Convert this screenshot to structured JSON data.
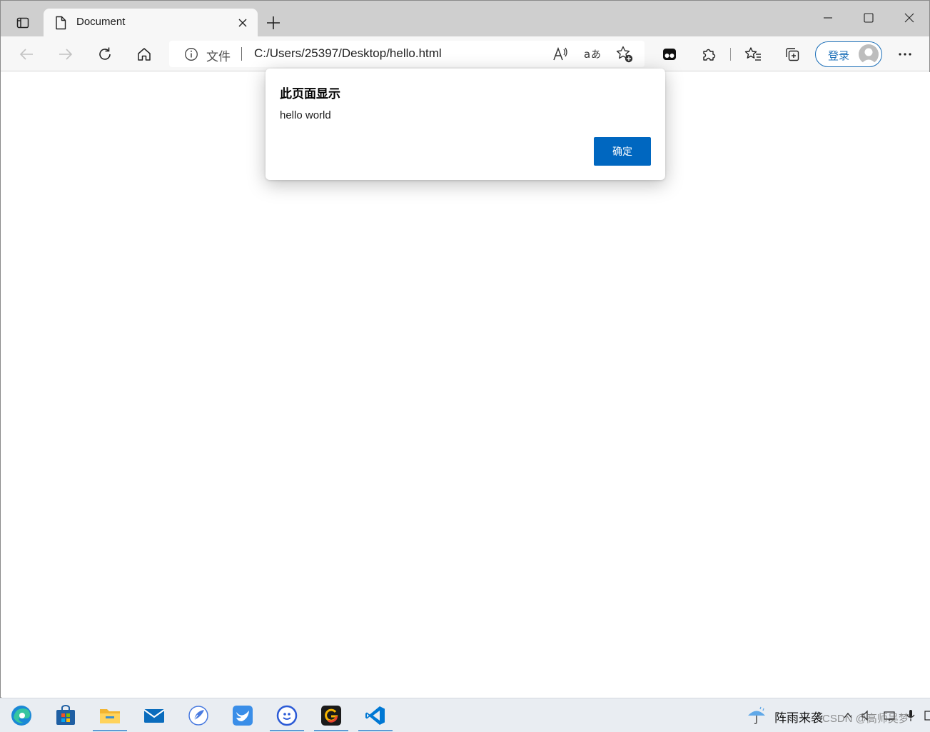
{
  "browser": {
    "tab": {
      "title": "Document"
    },
    "address": {
      "scheme_label": "文件",
      "url": "C:/Users/25397/Desktop/hello.html"
    },
    "signin_label": "登录"
  },
  "dialog": {
    "title": "此页面显示",
    "message": "hello world",
    "ok_label": "确定"
  },
  "taskbar": {
    "weather_text": "阵雨来袭",
    "watermark": "CSDN @高师吴梦",
    "apps": [
      "edge-icon",
      "store-icon",
      "file-explorer-icon",
      "mail-icon",
      "feather-app-icon",
      "bird-app-icon",
      "chat-app-icon",
      "g-app-icon",
      "vscode-icon"
    ]
  },
  "colors": {
    "accent": "#0067c0",
    "signin_blue": "#1c6fb8",
    "vscode_blue": "#0078d4"
  }
}
